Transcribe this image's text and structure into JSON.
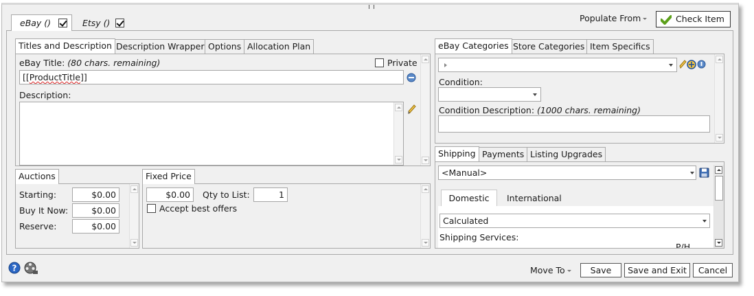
{
  "top_tabs": [
    {
      "label": "eBay ()",
      "checked": true
    },
    {
      "label": "Etsy ()",
      "checked": true
    }
  ],
  "header": {
    "populate_from_label": "Populate From",
    "check_item_label": "Check Item"
  },
  "titles_panel": {
    "tabs": [
      "Titles and Description",
      "Description Wrapper",
      "Options",
      "Allocation Plan"
    ],
    "ebay_title_label": "eBay Title:",
    "ebay_title_remaining": "(80 chars. remaining)",
    "private_label": "Private",
    "title_prefix": "[[",
    "title_word": "ProductTitle",
    "title_suffix": "]]",
    "description_label": "Description:",
    "description_value": ""
  },
  "auctions": {
    "tab": "Auctions",
    "starting_label": "Starting:",
    "starting_value": "$0.00",
    "buy_it_now_label": "Buy It Now:",
    "buy_it_now_value": "$0.00",
    "reserve_label": "Reserve:",
    "reserve_value": "$0.00"
  },
  "fixed_price": {
    "tab": "Fixed Price",
    "price_value": "$0.00",
    "qty_label": "Qty to List:",
    "qty_value": "1",
    "accept_offers_label": "Accept best offers"
  },
  "categories_panel": {
    "tabs": [
      "eBay Categories",
      "Store Categories",
      "Item Specifics"
    ],
    "condition_label": "Condition:",
    "condition_value": "",
    "condition_desc_label": "Condition Description:",
    "condition_desc_remaining": "(1000 chars. remaining)",
    "condition_desc_value": ""
  },
  "shipping_panel": {
    "tabs": [
      "Shipping",
      "Payments",
      "Listing Upgrades"
    ],
    "profile_value": "<Manual>",
    "sub_tabs": [
      "Domestic",
      "International"
    ],
    "type_value": "Calculated",
    "services_label": "Shipping Services:",
    "ph_label": "P/H"
  },
  "footer": {
    "move_to_label": "Move To",
    "save_label": "Save",
    "save_exit_label": "Save and Exit",
    "cancel_label": "Cancel"
  },
  "colors": {
    "accent_green": "#5ca01a",
    "help_blue": "#2a66c4",
    "border": "#a9a9a9"
  }
}
